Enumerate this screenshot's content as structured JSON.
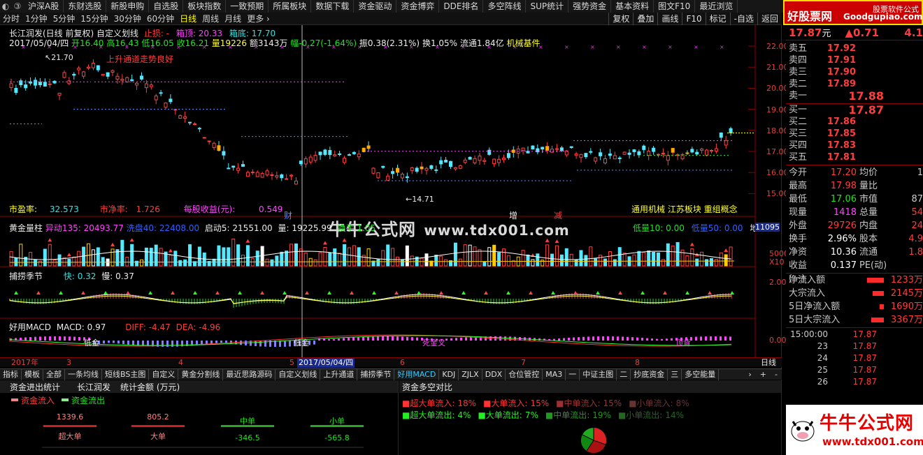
{
  "top_toolbar": [
    "沪深A股",
    "东财选股",
    "新股申购",
    "自选股",
    "板块指数",
    "一致预期",
    "所属板块",
    "数据下载",
    "资金驱动",
    "资金博弈",
    "DDE排名",
    "多空阵线",
    "SUP统计",
    "强势资金",
    "基本资料",
    "图文F10",
    "最近浏览"
  ],
  "brand": {
    "name": "好股票网",
    "url": "Goodgupiao.com",
    "sub": "股票软件公式"
  },
  "period_tabs": [
    {
      "label": "分时",
      "active": false
    },
    {
      "label": "1分钟",
      "active": false
    },
    {
      "label": "5分钟",
      "active": false
    },
    {
      "label": "15分钟",
      "active": false
    },
    {
      "label": "30分钟",
      "active": false
    },
    {
      "label": "60分钟",
      "active": false
    },
    {
      "label": "日线",
      "active": true
    },
    {
      "label": "周线",
      "active": false
    },
    {
      "label": "月线",
      "active": false
    },
    {
      "label": "更多 ›",
      "active": false
    }
  ],
  "right_tools": [
    "复权",
    "叠加",
    "画线",
    "F10",
    "标记",
    "-自选",
    "返回"
  ],
  "chart_header": {
    "line1": {
      "name": "长江润发(日线 前复权) 自定义划线",
      "stop": "止损: -",
      "top": "箱顶: 20.33",
      "bottom": "箱底: 17.70"
    },
    "line2": {
      "date": "2017/05/04/四",
      "open": "开16.40",
      "high": "高16.43",
      "low": "低16.05",
      "close": "收16.21",
      "vol": "量19226",
      "amt": "额3143万",
      "chg": "幅-0.27(-1.64%)",
      "amp": "振0.38(2.31%)",
      "turn": "换1.05%",
      "float": "流通1.84亿",
      "tag": "机械基件"
    }
  },
  "annotations": {
    "high_mark": "21.70",
    "low_mark": "14.71",
    "trend_text": "上升通道走势良好",
    "cai": "财",
    "zeng": "增",
    "jian": "减"
  },
  "fundamentals": {
    "pe_label": "市盈率:",
    "pe": "32.573",
    "pb_label": "市净率:",
    "pb": "1.726",
    "eps_label": "每股收益(元):",
    "eps": "0.549",
    "concepts": "通用机械 江苏板块 重组概念"
  },
  "watermark": {
    "cn": "牛牛公式网",
    "url": "www.tdx001.com"
  },
  "price_axis": [
    "22.00",
    "21.00",
    "20.00",
    "19.00",
    "18.00",
    "17.00",
    "16.00",
    "15.00"
  ],
  "vol_panel": {
    "title": "黄金量柱",
    "y1": "异动135: 20493.77",
    "y2": "洗盘40: 22408.00",
    "y3": "启动5: 21551.00",
    "y4": "量: 19225.99",
    "y5": "换手",
    "y6": "1.05",
    "low_label": "低量10: 0.00",
    "low2": "低量50: 0.00",
    "dl": "地量",
    "scale_hi": "11095",
    "scale_mid": "5000",
    "scale_lo": "X10"
  },
  "season_panel": {
    "title": "捕捞季节",
    "fast": "快: 0.32",
    "slow": "慢: 0.37",
    "axis": "2.00"
  },
  "macd_panel": {
    "title": "好用MACD",
    "macd": "MACD: 0.97",
    "diff": "DIFF: -4.47",
    "dea": "DEA: -4.96",
    "axis": "0.00",
    "lbl1": "低金",
    "lbl2": "低金",
    "lbl3": "死金叉",
    "lbl4": "顶背"
  },
  "date_axis": {
    "labels": [
      "2017年",
      "3",
      "4",
      "5",
      "6",
      "7",
      "8"
    ],
    "cursor": "2017/05/04/四",
    "period": "日线"
  },
  "bottom_tabs": [
    "指标",
    "模板",
    "全部",
    "一条均线",
    "短线BS主图",
    "自定义",
    "黄金分割线",
    "最近思路源码",
    "自定义划线",
    "上升通道",
    "捕捞季节",
    "好用MACD",
    "KDJ",
    "ZJLX",
    "DDX",
    "仓位管控",
    "MA3",
    "一",
    "中证主图",
    "二",
    "抄底资金",
    "三",
    "多空能量"
  ],
  "capital_stats": {
    "title": "资金进出统计",
    "stock": "长江润发",
    "unit": "统计金额 (万元)",
    "legend_in": "资金流入",
    "legend_out": "资金流出",
    "cols": [
      {
        "name": "超大单",
        "val": "1339.6",
        "sign": "in"
      },
      {
        "name": "大单",
        "val": "805.2",
        "sign": "in"
      },
      {
        "name": "中单",
        "val": "-346.5",
        "sign": "out"
      },
      {
        "name": "小单",
        "val": "-565.8",
        "sign": "out"
      }
    ]
  },
  "capital_compare": {
    "title": "资金多空对比",
    "inflow": [
      {
        "label": "超大单流入:",
        "pct": "18%"
      },
      {
        "label": "大单流入:",
        "pct": "15%"
      },
      {
        "label": "中单流入:",
        "pct": "15%"
      },
      {
        "label": "小单流入:",
        "pct": "8%"
      }
    ],
    "outflow": [
      {
        "label": "超大单流出:",
        "pct": "4%"
      },
      {
        "label": "大单流出:",
        "pct": "7%"
      },
      {
        "label": "中单流出:",
        "pct": "19%"
      },
      {
        "label": "小单流出:",
        "pct": "14%"
      }
    ]
  },
  "quote": {
    "price": "17.87",
    "unit": "元",
    "change": "▲0.71",
    "pct": "4.1",
    "asks": [
      {
        "label": "卖五",
        "price": "17.92"
      },
      {
        "label": "卖四",
        "price": "17.91"
      },
      {
        "label": "卖三",
        "price": "17.90"
      },
      {
        "label": "卖二",
        "price": "17.89"
      },
      {
        "label": "卖一",
        "price": "17.88"
      }
    ],
    "bids": [
      {
        "label": "买一",
        "price": "17.87"
      },
      {
        "label": "买二",
        "price": "17.86"
      },
      {
        "label": "买三",
        "price": "17.85"
      },
      {
        "label": "买四",
        "price": "17.83"
      },
      {
        "label": "买五",
        "price": "17.81"
      }
    ],
    "stats": [
      {
        "k": "今开",
        "a": "17.20",
        "k2": "均价",
        "b": "1"
      },
      {
        "k": "最高",
        "a": "17.98",
        "k2": "量比",
        "b": ""
      },
      {
        "k": "最低",
        "a": "17.06",
        "k2": "市值",
        "b": "87"
      },
      {
        "k": "现量",
        "a": "1418",
        "k2": "总量",
        "b": "54"
      },
      {
        "k": "外盘",
        "a": "29726",
        "k2": "内盘",
        "b": "24"
      },
      {
        "k": "换手",
        "a": "2.96%",
        "k2": "股本",
        "b": "4.9"
      },
      {
        "k": "净资",
        "a": "10.36",
        "k2": "流通",
        "b": "1.8"
      },
      {
        "k": "收益(一)",
        "a": "0.137",
        "k2": "PE(动)",
        "b": ""
      }
    ],
    "flows": [
      {
        "n": "净流入额",
        "v": "1233万",
        "w": 24
      },
      {
        "n": "大宗流入",
        "v": "2145万",
        "w": 16
      },
      {
        "n": "5日净流入额",
        "v": "1690万",
        "w": 6
      },
      {
        "n": "5日大宗流入",
        "v": "3367万",
        "w": 18
      }
    ],
    "ticks": [
      {
        "t": "15:00:00",
        "p": "17.87"
      },
      {
        "t": "23",
        "p": "17.87"
      },
      {
        "t": "24",
        "p": "17.87"
      },
      {
        "t": "25",
        "p": "17.87"
      },
      {
        "t": "26",
        "p": "17.87"
      }
    ]
  },
  "footer_logo": {
    "cn": "牛牛公式网",
    "url": "www.tdx001.com"
  }
}
